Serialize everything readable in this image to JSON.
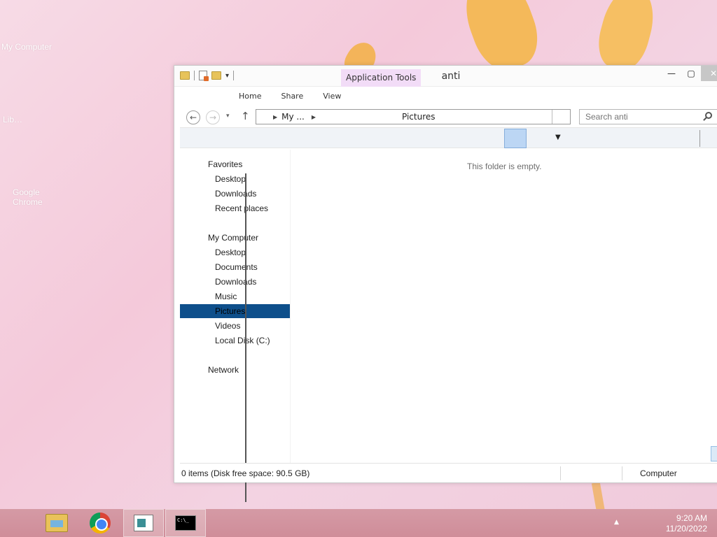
{
  "desktop": {
    "icons": [
      "My Computer",
      "Lib…",
      "Google Chrome"
    ]
  },
  "window": {
    "title": "anti",
    "context_tab": "Application Tools",
    "ribbon_tabs": [
      "Home",
      "Share",
      "View"
    ],
    "address": {
      "segments": [
        "My ..."
      ],
      "current": "Pictures"
    },
    "search_placeholder": "Search anti",
    "empty_message": "This folder is empty.",
    "nav": {
      "favorites": {
        "label": "Favorites",
        "items": [
          "Desktop",
          "Downloads",
          "Recent places"
        ]
      },
      "computer": {
        "label": "My Computer",
        "items": [
          "Desktop",
          "Documents",
          "Downloads",
          "Music",
          "Pictures",
          "Videos",
          "Local Disk (C:)"
        ]
      },
      "network": {
        "label": "Network"
      },
      "selected": "Pictures"
    },
    "status": {
      "items": "0 items (Disk free space: 90.5 GB)",
      "location": "Computer"
    },
    "icons": {
      "back": "back-arrow-icon",
      "forward": "forward-arrow-icon",
      "up": "up-arrow-icon",
      "search": "search-icon"
    }
  },
  "taskbar": {
    "apps": [
      "File Explorer",
      "Google Chrome",
      "Application",
      "Command Prompt"
    ],
    "time": "9:20 AM",
    "date": "11/20/2022",
    "colors": {
      "bar": "#d59aa5",
      "selection": "#0e4f8b",
      "context_tab": "#f2dcf7"
    }
  }
}
